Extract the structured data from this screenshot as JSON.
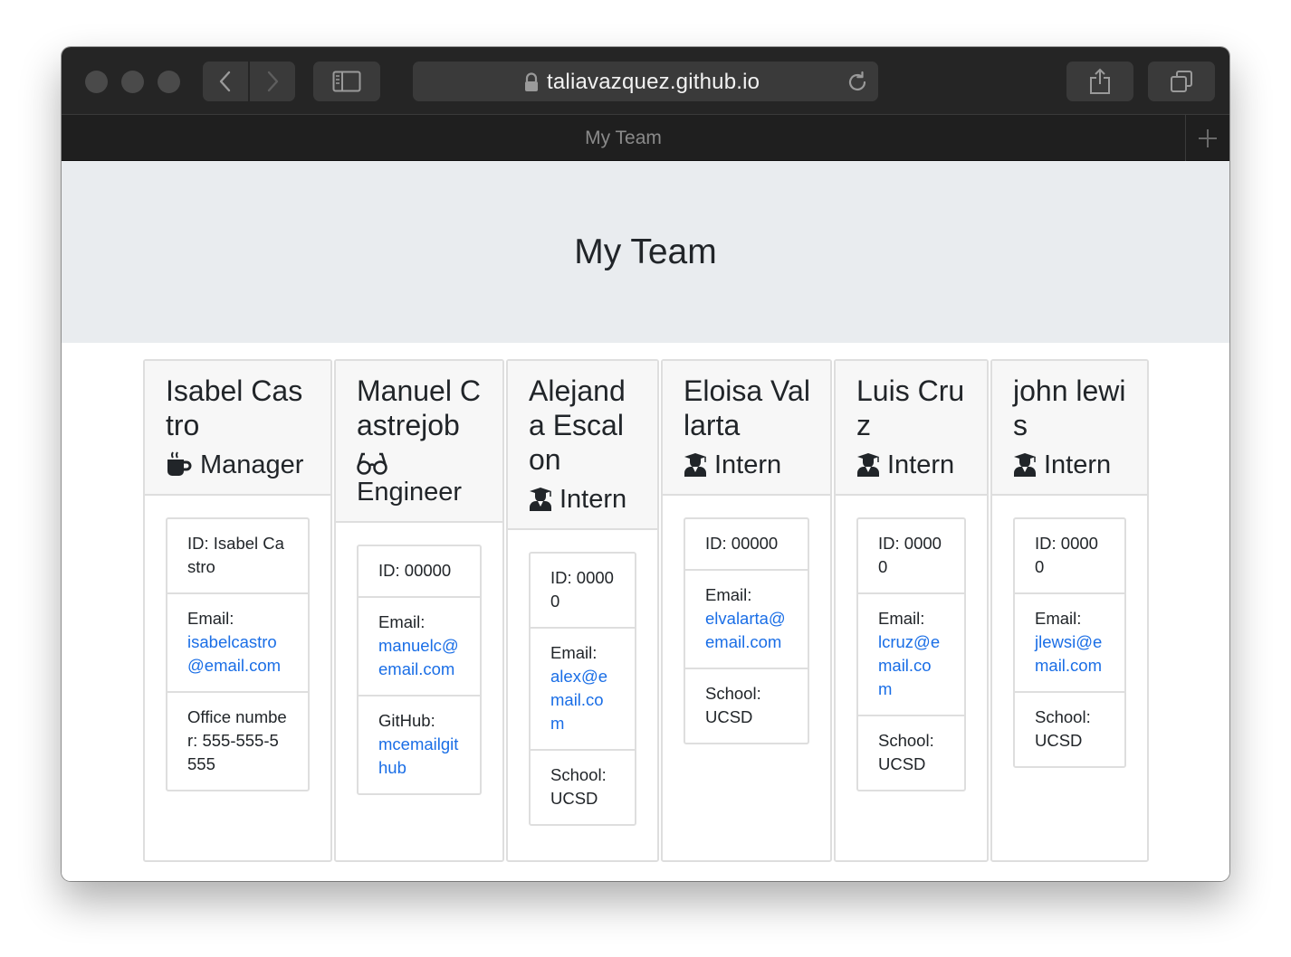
{
  "browser": {
    "url": "taliavazquez.github.io",
    "tab_title": "My Team"
  },
  "page": {
    "heading": "My Team"
  },
  "employees": [
    {
      "name": "Isabel Castro",
      "role": "Manager",
      "role_icon": "coffee-icon",
      "id_label": "ID: Isabel Castro",
      "email_label": "Email:",
      "email": "isabelcastro@email.com",
      "extra_label": "Office number:",
      "extra_value": "555-555-5555"
    },
    {
      "name": "Manuel Castrejob",
      "role": "Engineer",
      "role_icon": "glasses-icon",
      "id_label": "ID: 00000",
      "email_label": "Email:",
      "email": "manuelc@email.com",
      "extra_label": "GitHub:",
      "extra_value": "mcemailgithub"
    },
    {
      "name": "Alejanda Escalon",
      "role": "Intern",
      "role_icon": "graduate-icon",
      "id_label": "ID: 00000",
      "email_label": "Email:",
      "email": "alex@email.com",
      "extra_label": "School:",
      "extra_value": "UCSD"
    },
    {
      "name": "Eloisa Vallarta",
      "role": "Intern",
      "role_icon": "graduate-icon",
      "id_label": "ID: 00000",
      "email_label": "Email:",
      "email": "elvalarta@email.com",
      "extra_label": "School:",
      "extra_value": "UCSD"
    },
    {
      "name": "Luis Cruz",
      "role": "Intern",
      "role_icon": "graduate-icon",
      "id_label": "ID: 00000",
      "email_label": "Email:",
      "email": "lcruz@email.com",
      "extra_label": "School:",
      "extra_value": "UCSD"
    },
    {
      "name": "john lewis",
      "role": "Intern",
      "role_icon": "graduate-icon",
      "id_label": "ID: 00000",
      "email_label": "Email:",
      "email": "jlewsi@email.com",
      "extra_label": "School:",
      "extra_value": "UCSD"
    }
  ]
}
